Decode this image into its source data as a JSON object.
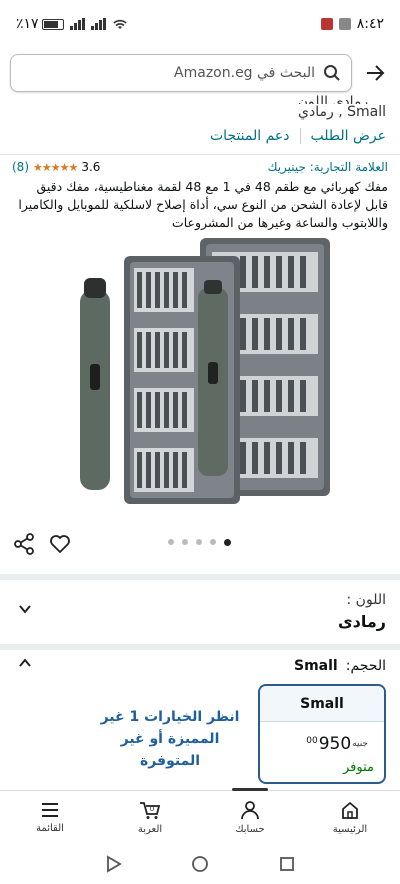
{
  "status_bar": {
    "time": "٨:٤٢",
    "battery": "٪١٧"
  },
  "search": {
    "placeholder": "البحث في Amazon.eg"
  },
  "product": {
    "title_partial": "... رمادي اللون ...",
    "variant_line": "Small , رمادي",
    "links": [
      "عرض الطلب",
      "دعم المنتجات"
    ],
    "brand_label": "العلامة التجارية: جينيريك",
    "rating_value": "3.6",
    "rating_count": "(8)",
    "stars": "★★★★★",
    "description": "مفك كهربائي مع طقم 48 في 1 مع 48 لقمة مغناطيسية، مفك دقيق قابل لإعادة الشحن من النوع سي، أداة إصلاح لاسلكية للموبايل والكاميرا واللابتوب والساعة وغيرها من المشروعات"
  },
  "carousel": {
    "dot_count": 5,
    "active_index": 4
  },
  "color": {
    "label": "اللون :",
    "value": "رمادى"
  },
  "size": {
    "label": "الحجم:",
    "value": "Small",
    "card": {
      "name": "Small",
      "price_int": "950",
      "price_frac": "00",
      "currency": "جنيه",
      "availability": "متوفر"
    },
    "more_options": "انظر الخيارات 1 غير المميزة أو غير المتوفرة"
  },
  "bottom_nav": [
    {
      "label": "الرئيسية",
      "icon": "home-icon"
    },
    {
      "label": "حسابك",
      "icon": "user-icon"
    },
    {
      "label": "العربة",
      "icon": "cart-icon"
    },
    {
      "label": "القائمة",
      "icon": "menu-icon"
    }
  ],
  "colors": {
    "link": "#007185",
    "accent_border": "#2b5c8c",
    "available": "#007600",
    "stars": "#de7921"
  }
}
